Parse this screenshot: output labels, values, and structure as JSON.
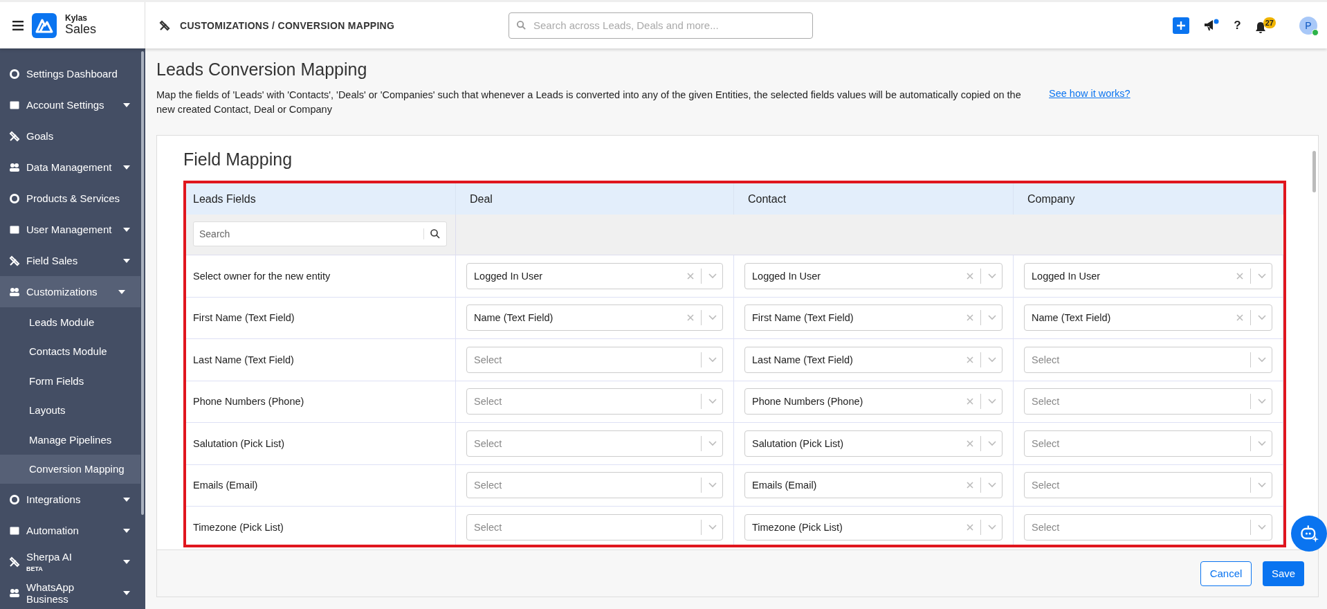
{
  "header": {
    "brand_top": "Kylas",
    "brand_bottom": "Sales",
    "breadcrumb": "CUSTOMIZATIONS / CONVERSION MAPPING",
    "search": {
      "placeholder": "Search across Leads, Deals and more..."
    },
    "notifications": "27",
    "help": "?",
    "avatar": "P"
  },
  "sidebar": {
    "items": [
      {
        "label": "Settings Dashboard",
        "expandable": false,
        "selected": false
      },
      {
        "label": "Account Settings",
        "expandable": true,
        "selected": false
      },
      {
        "label": "Goals",
        "expandable": false,
        "selected": false
      },
      {
        "label": "Data Management",
        "expandable": true,
        "selected": false
      },
      {
        "label": "Products & Services",
        "expandable": false,
        "selected": false
      },
      {
        "label": "User Management",
        "expandable": true,
        "selected": false
      },
      {
        "label": "Field Sales",
        "expandable": true,
        "selected": false
      },
      {
        "label": "Customizations",
        "expandable": true,
        "selected": true,
        "children": [
          {
            "label": "Leads Module",
            "selected": false
          },
          {
            "label": "Contacts Module",
            "selected": false
          },
          {
            "label": "Form Fields",
            "selected": false
          },
          {
            "label": "Layouts",
            "selected": false
          },
          {
            "label": "Manage Pipelines",
            "selected": false
          },
          {
            "label": "Conversion Mapping",
            "selected": true
          }
        ]
      },
      {
        "label": "Integrations",
        "expandable": true,
        "selected": false
      },
      {
        "label": "Automation",
        "expandable": true,
        "selected": false
      },
      {
        "label": "Sherpa AI",
        "badge": "BETA",
        "expandable": true,
        "selected": false
      },
      {
        "label": "WhatsApp Business",
        "expandable": true,
        "selected": false
      }
    ]
  },
  "page": {
    "title": "Leads Conversion Mapping",
    "description": "Map the fields of 'Leads' with 'Contacts', 'Deals' or 'Companies' such that whenever a Leads is converted into any of the given Entities, the selected fields values will be automatically copied on the new created Contact, Deal or Company",
    "link": "See how it works?"
  },
  "card": {
    "title": "Field Mapping",
    "table": {
      "columns": [
        "Leads Fields",
        "Deal",
        "Contact",
        "Company"
      ],
      "search": {
        "placeholder": "Search"
      },
      "rows": [
        {
          "cells": [
            {
              "kind": "label",
              "text": "Select owner for the new entity"
            },
            {
              "kind": "select",
              "value": "Logged In User"
            },
            {
              "kind": "select",
              "value": "Logged In User"
            },
            {
              "kind": "select",
              "value": "Logged In User"
            }
          ]
        },
        {
          "cells": [
            {
              "kind": "label",
              "text": "First Name (Text Field)"
            },
            {
              "kind": "select",
              "value": "Name (Text Field)"
            },
            {
              "kind": "select",
              "value": "First Name (Text Field)"
            },
            {
              "kind": "select",
              "value": "Name (Text Field)"
            }
          ]
        },
        {
          "cells": [
            {
              "kind": "label",
              "text": "Last Name (Text Field)"
            },
            {
              "kind": "select",
              "placeholder": "Select"
            },
            {
              "kind": "select",
              "value": "Last Name (Text Field)"
            },
            {
              "kind": "select",
              "placeholder": "Select"
            }
          ]
        },
        {
          "cells": [
            {
              "kind": "label",
              "text": "Phone Numbers (Phone)"
            },
            {
              "kind": "select",
              "placeholder": "Select"
            },
            {
              "kind": "select",
              "value": "Phone Numbers (Phone)"
            },
            {
              "kind": "select",
              "placeholder": "Select"
            }
          ]
        },
        {
          "cells": [
            {
              "kind": "label",
              "text": "Salutation (Pick List)"
            },
            {
              "kind": "select",
              "placeholder": "Select"
            },
            {
              "kind": "select",
              "value": "Salutation (Pick List)"
            },
            {
              "kind": "select",
              "placeholder": "Select"
            }
          ]
        },
        {
          "cells": [
            {
              "kind": "label",
              "text": "Emails (Email)"
            },
            {
              "kind": "select",
              "placeholder": "Select"
            },
            {
              "kind": "select",
              "value": "Emails (Email)"
            },
            {
              "kind": "select",
              "placeholder": "Select"
            }
          ]
        },
        {
          "cells": [
            {
              "kind": "label",
              "text": "Timezone (Pick List)"
            },
            {
              "kind": "select",
              "placeholder": "Select"
            },
            {
              "kind": "select",
              "value": "Timezone (Pick List)"
            },
            {
              "kind": "select",
              "placeholder": "Select"
            }
          ]
        }
      ]
    },
    "buttons": [
      {
        "label": "Cancel",
        "kind": "secondary"
      },
      {
        "label": "Save",
        "kind": "primary"
      }
    ]
  }
}
